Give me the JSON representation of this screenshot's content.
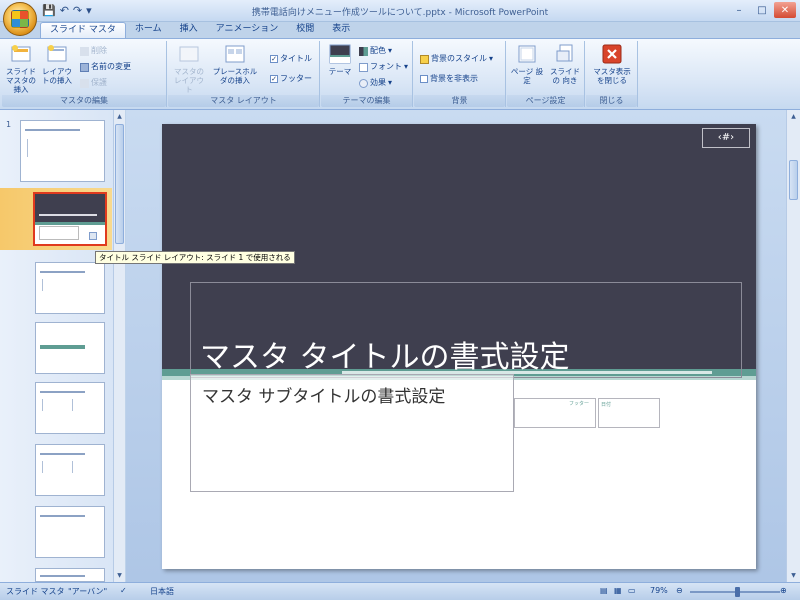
{
  "window": {
    "title": "携帯電話向けメニュー作成ツールについて.pptx - Microsoft PowerPoint",
    "controls": [
      "–",
      "□",
      "✕"
    ]
  },
  "qat": {
    "save": "💾",
    "undo": "↶",
    "redo": "↷",
    "more": "▾"
  },
  "tabs": [
    {
      "label": "スライド マスタ",
      "active": true
    },
    {
      "label": "ホーム"
    },
    {
      "label": "挿入"
    },
    {
      "label": "アニメーション"
    },
    {
      "label": "校閲"
    },
    {
      "label": "表示"
    }
  ],
  "ribbon": {
    "groups": {
      "master_edit": {
        "label": "マスタの編集",
        "insert_master": "スライド マスタの挿入",
        "insert_layout": "レイアウトの挿入",
        "delete": "削除",
        "rename": "名前の変更",
        "preserve": "保護"
      },
      "master_layout": {
        "label": "マスタ レイアウト",
        "master_layout_btn": "マスタの レイアウト",
        "insert_placeholder": "プレースホルダの挿入",
        "title_check": "タイトル",
        "footer_check": "フッター"
      },
      "theme_edit": {
        "label": "テーマの編集",
        "themes": "テーマ",
        "colors": "配色",
        "fonts": "フォント",
        "effects": "効果"
      },
      "background": {
        "label": "背景",
        "bg_styles": "背景のスタイル",
        "hide_bg": "背景を非表示"
      },
      "page_setup": {
        "label": "ページ設定",
        "page_setup_btn": "ページ 設定",
        "orientation": "スライドの 向き"
      },
      "close": {
        "label": "閉じる",
        "close_master": "マスタ表示 を閉じる"
      }
    }
  },
  "thumbnails": {
    "tooltip": "タイトル スライド レイアウト: スライド 1 で使用される",
    "master_number": "1"
  },
  "slide": {
    "title": "マスタ タイトルの書式設定",
    "subtitle": "マスタ サブタイトルの書式設定",
    "page_num": "‹#›",
    "footer_small": "フッター",
    "date_small": "日付"
  },
  "statusbar": {
    "view": "スライド マスタ",
    "theme": "\"アーバン\"",
    "language": "日本語",
    "zoom": "79%"
  },
  "colors": {
    "slide_dark": "#3f3f4f",
    "accent_teal": "#5f9d93",
    "ribbon_text": "#15428b"
  }
}
